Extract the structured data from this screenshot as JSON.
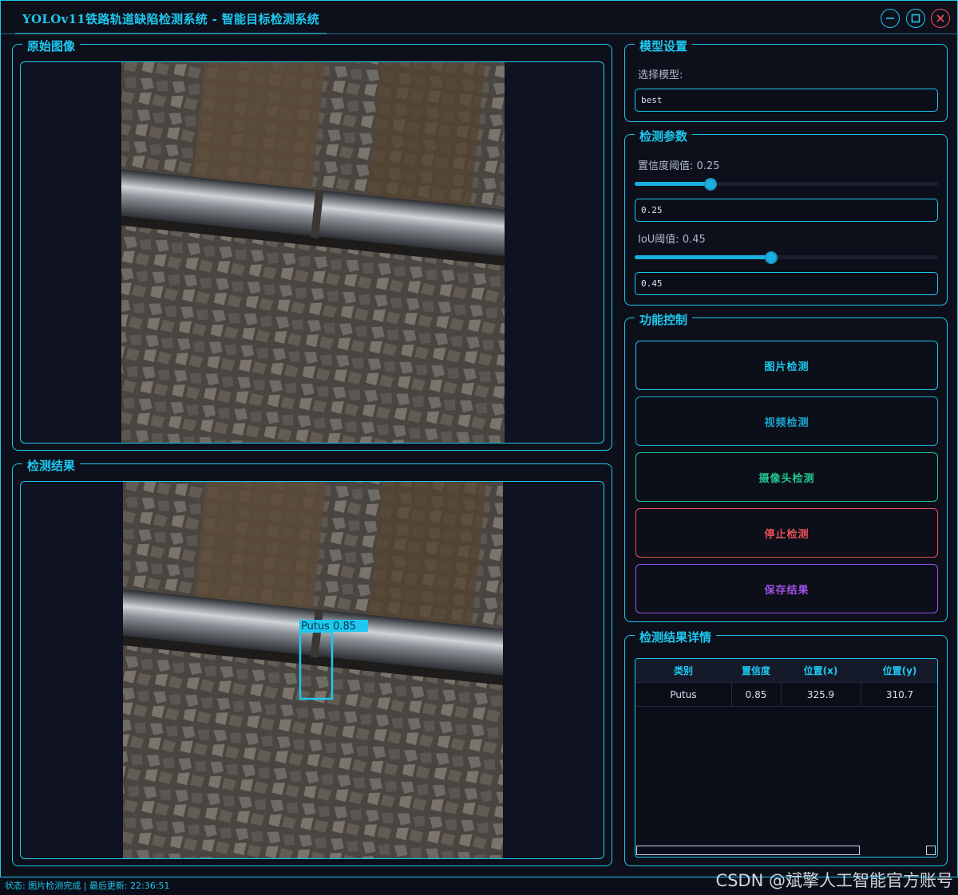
{
  "window": {
    "title": "YOLOv11铁路轨道缺陷检测系统 - 智能目标检测系统"
  },
  "icons": {
    "minimize": "minimize-icon",
    "maximize": "maximize-icon",
    "close": "close-icon"
  },
  "left": {
    "original_title": "原始图像",
    "result_title": "检测结果"
  },
  "detection_overlay": {
    "label": "Putus 0.85",
    "color": "#1ec8f0"
  },
  "model": {
    "title": "模型设置",
    "select_label": "选择模型:",
    "selected": "best"
  },
  "params": {
    "title": "检测参数",
    "conf_label": "置信度阈值: 0.25",
    "conf_value": "0.25",
    "conf_level": 0.25,
    "iou_label": "IoU阈值: 0.45",
    "iou_value": "0.45",
    "iou_level": 0.45
  },
  "controls": {
    "title": "功能控制",
    "buttons": [
      {
        "label": "图片检测",
        "color": "#1ec8f0"
      },
      {
        "label": "视频检测",
        "color": "#1aa8d0"
      },
      {
        "label": "摄像头检测",
        "color": "#20c890"
      },
      {
        "label": "停止检测",
        "color": "#e8505a"
      },
      {
        "label": "保存结果",
        "color": "#a050e8"
      }
    ]
  },
  "results": {
    "title": "检测结果详情",
    "columns": [
      "类别",
      "置信度",
      "位置(x)",
      "位置(y)"
    ],
    "rows": [
      [
        "Putus",
        "0.85",
        "325.9",
        "310.7"
      ]
    ]
  },
  "status": {
    "text": "状态: 图片检测完成 | 最后更新: 22:36:51"
  },
  "watermark": "CSDN @斌擎人工智能官方账号"
}
